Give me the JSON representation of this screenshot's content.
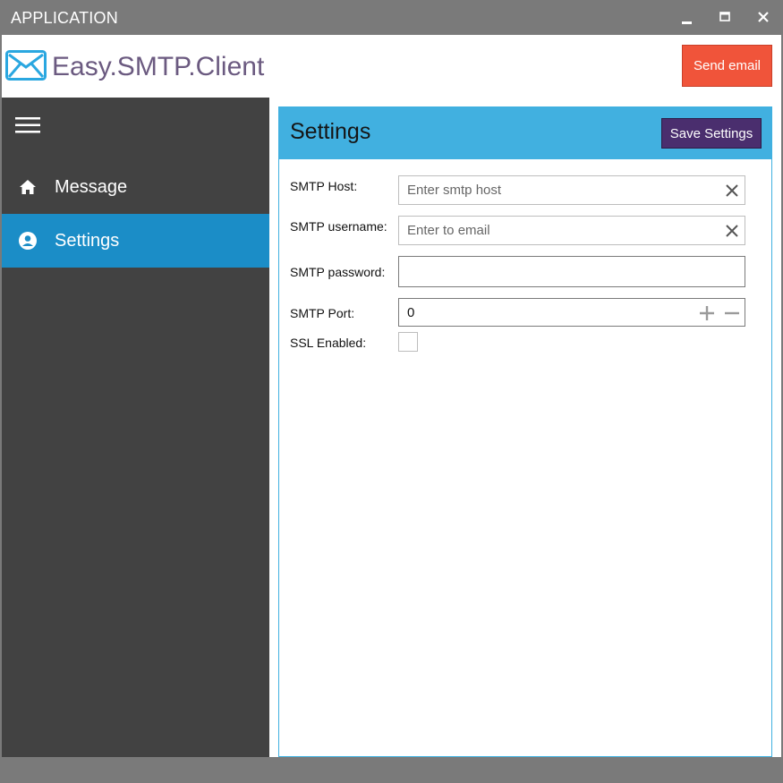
{
  "window": {
    "title": "APPLICATION",
    "controls": [
      "minimize-icon",
      "maximize-icon",
      "close-icon"
    ]
  },
  "header": {
    "logo_icon": "envelope-icon",
    "app_title": "Easy.SMTP.Client",
    "send_button_label": "Send email"
  },
  "sidebar": {
    "menu_icon": "hamburger-icon",
    "items": [
      {
        "label": "Message",
        "icon": "home-icon",
        "active": false
      },
      {
        "label": "Settings",
        "icon": "account-circle-icon",
        "active": true
      }
    ]
  },
  "settings": {
    "title": "Settings",
    "save_button_label": "Save Settings",
    "fields": {
      "host": {
        "label": "SMTP Host:",
        "value": "",
        "placeholder": "Enter smtp host"
      },
      "username": {
        "label": "SMTP username:",
        "value": "",
        "placeholder": "Enter to email"
      },
      "password": {
        "label": "SMTP password:",
        "value": ""
      },
      "port": {
        "label": "SMTP Port:",
        "value": "0"
      },
      "ssl": {
        "label": "SSL Enabled:",
        "checked": false
      }
    }
  },
  "colors": {
    "titlebar": "#7a7a7a",
    "sidebar": "#424242",
    "sidebar_active": "#1b8dc7",
    "settings_header": "#41b0e0",
    "send_button": "#f0543a",
    "save_button": "#4a2e6e",
    "app_title": "#6b5a80"
  }
}
